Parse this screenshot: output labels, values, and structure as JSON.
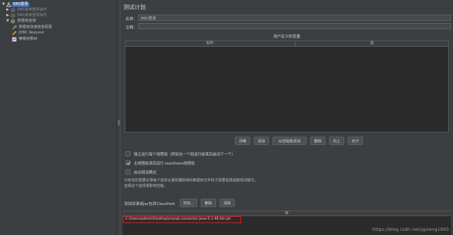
{
  "tree": {
    "items": [
      {
        "label": "BBS登录",
        "toggle": "▼",
        "icon": "test-plan-icon",
        "selected": true
      },
      {
        "label": "BBS简单登录操作",
        "toggle": "▶",
        "icon": "gear-icon",
        "dim": true
      },
      {
        "label": "BBS简单登录操作",
        "toggle": "▶",
        "icon": "gear-icon",
        "dim": true
      },
      {
        "label": "数据库连接",
        "toggle": "▼",
        "icon": "gear-icon",
        "dim": false
      },
      {
        "label": "数据库连接信息配置",
        "toggle": "",
        "icon": "wrench-icon",
        "dim": false
      },
      {
        "label": "JDBC Request",
        "toggle": "",
        "icon": "pencil-icon",
        "dim": false
      },
      {
        "label": "察看结果树",
        "toggle": "",
        "icon": "chart-icon",
        "dim": false
      }
    ]
  },
  "panel": {
    "title": "测试计划",
    "name_label": "名称:",
    "name_value": "BBS登录",
    "comment_label": "注释:",
    "comment_value": "",
    "variables": {
      "title": "用户定义的变量",
      "col_name": "名称:",
      "col_value": "值"
    },
    "buttons": {
      "detail": "详细",
      "add": "添加",
      "add_from_clipboard": "从剪贴板添加",
      "delete": "删除",
      "up": "向上",
      "down": "向下"
    },
    "options": {
      "serialize": "独立运行每个线程组（例如在一个组运行结束后启动下一个）",
      "teardown": "主线程结束后运行 tearDown线程组",
      "functional": "启动调试模式"
    },
    "note_line1": "只有当你需要记录每个请求从服务器取得的数据到文件时才需要选择函数测试模式。",
    "note_line2": "选择这个选项很影响性能。",
    "classpath": {
      "label": "添加目录或jar包到ClassPath",
      "browse": "浏览...",
      "delete": "删除",
      "clear": "清除",
      "lib_header": "库",
      "lib_entry": "C:\\Users\\admin\\Desktop\\mysql-connector-java-5.1.46-bin.jar"
    }
  },
  "watermark": "https://blog.csdn.net/ypzeng1993"
}
